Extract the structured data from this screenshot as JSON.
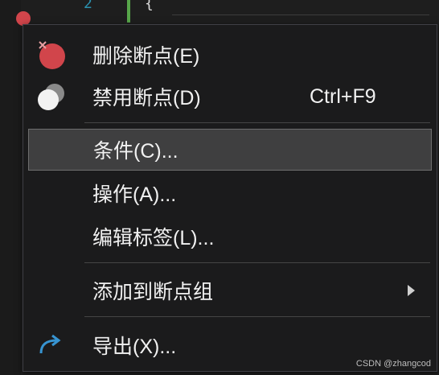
{
  "editor": {
    "line_number": "2",
    "code_line": "{"
  },
  "menu": {
    "items": [
      {
        "label": "删除断点(E)",
        "icon": "breakpoint-delete-icon",
        "shortcut": ""
      },
      {
        "label": "禁用断点(D)",
        "icon": "breakpoint-disable-icon",
        "shortcut": "Ctrl+F9"
      },
      {
        "label": "条件(C)...",
        "selected": true
      },
      {
        "label": "操作(A)..."
      },
      {
        "label": "编辑标签(L)..."
      },
      {
        "label": "添加到断点组",
        "has_submenu": true
      },
      {
        "label": "导出(X)...",
        "icon": "export-arrow-icon"
      }
    ]
  },
  "colors": {
    "menu_bg": "#1b1b1c",
    "selected_bg": "#3f3f40",
    "breakpoint_red": "#d1454b",
    "export_blue": "#3794d1"
  },
  "watermark": "CSDN @zhangcod"
}
